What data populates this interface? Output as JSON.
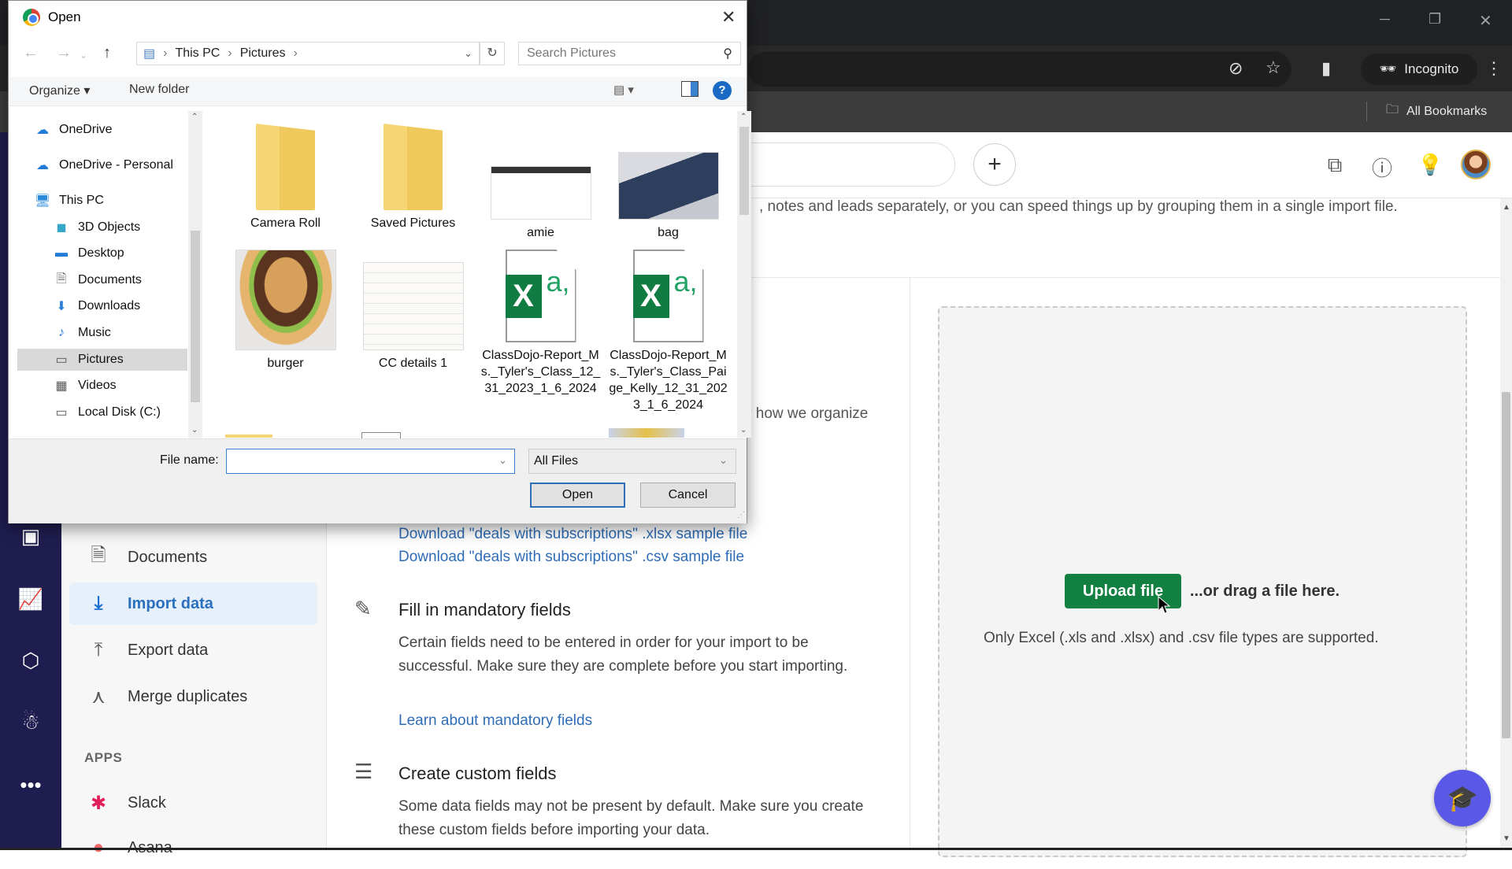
{
  "browser": {
    "incognito_label": "Incognito",
    "bookmarks_label": "All Bookmarks"
  },
  "app": {
    "intro_text": ", notes and leads separately, or you can speed things up by grouping them in a single import file.",
    "behind_text": "y how we organize",
    "subnav": [
      {
        "label": "Documents",
        "icon": "document-icon",
        "glyph": "🗎",
        "active": false
      },
      {
        "label": "Import data",
        "icon": "download-icon",
        "glyph": "⤓",
        "active": true
      },
      {
        "label": "Export data",
        "icon": "upload-icon",
        "glyph": "⤒",
        "active": false
      },
      {
        "label": "Merge duplicates",
        "icon": "merge-icon",
        "glyph": "⋏",
        "active": false
      }
    ],
    "apps_label": "APPS",
    "apps": [
      {
        "label": "Slack",
        "icon": "slack-icon"
      },
      {
        "label": "Asana",
        "icon": "asana-icon"
      }
    ],
    "links": {
      "xlsx_sample": "Download \"deals with subscriptions\" .xlsx sample file",
      "csv_sample": "Download \"deals with subscriptions\" .csv sample file",
      "learn_mandatory": "Learn about mandatory fields"
    },
    "sections": {
      "mandatory": {
        "title": "Fill in mandatory fields",
        "body": "Certain fields need to be entered in order for your import to be successful. Make sure they are complete before you start importing."
      },
      "custom": {
        "title": "Create custom fields",
        "body": "Some data fields may not be present by default. Make sure you create these custom fields before importing your data."
      }
    },
    "upload": {
      "button": "Upload file",
      "drag_text": "...or drag a file here.",
      "supported": "Only Excel (.xls and .xlsx) and .csv file types are supported."
    },
    "accent_color": "#118041",
    "rail_color": "#1f1d4f"
  },
  "dialog": {
    "title": "Open",
    "breadcrumb": [
      "This PC",
      "Pictures"
    ],
    "search_placeholder": "Search Pictures",
    "organize_label": "Organize ▾",
    "new_folder_label": "New folder",
    "nav_items": [
      {
        "label": "OneDrive",
        "icon": "cloud-icon",
        "glyph": "☁",
        "color": "#1f7bd6",
        "sub": false
      },
      {
        "label": "OneDrive - Personal",
        "icon": "cloud-icon",
        "glyph": "☁",
        "color": "#1f7bd6",
        "sub": false
      },
      {
        "label": "This PC",
        "icon": "computer-icon",
        "glyph": "🖥",
        "color": "#2b8ad8",
        "sub": false
      },
      {
        "label": "3D Objects",
        "icon": "cube-icon",
        "glyph": "◼",
        "color": "#35a7c9",
        "sub": true
      },
      {
        "label": "Desktop",
        "icon": "desktop-icon",
        "glyph": "▬",
        "color": "#1f7bd6",
        "sub": true
      },
      {
        "label": "Documents",
        "icon": "document-icon",
        "glyph": "🗎",
        "color": "#666",
        "sub": true
      },
      {
        "label": "Downloads",
        "icon": "download-icon",
        "glyph": "⬇",
        "color": "#2b7fd6",
        "sub": true
      },
      {
        "label": "Music",
        "icon": "music-icon",
        "glyph": "♪",
        "color": "#2b7fd6",
        "sub": true
      },
      {
        "label": "Pictures",
        "icon": "pictures-icon",
        "glyph": "▭",
        "color": "#555",
        "sub": true,
        "selected": true
      },
      {
        "label": "Videos",
        "icon": "video-icon",
        "glyph": "▦",
        "color": "#555",
        "sub": true
      },
      {
        "label": "Local Disk (C:)",
        "icon": "disk-icon",
        "glyph": "▭",
        "color": "#555",
        "sub": true
      }
    ],
    "files": [
      {
        "name": "Camera Roll",
        "type": "folder"
      },
      {
        "name": "Saved Pictures",
        "type": "folder"
      },
      {
        "name": "amie",
        "type": "image"
      },
      {
        "name": "bag",
        "type": "image"
      },
      {
        "name": "burger",
        "type": "image"
      },
      {
        "name": "CC details 1",
        "type": "image"
      },
      {
        "name": "ClassDojo-Report_Ms._Tyler's_Class_12_31_2023_1_6_2024",
        "type": "xlsx"
      },
      {
        "name": "ClassDojo-Report_Ms._Tyler's_Class_Paige_Kelly_12_31_2023_1_6_2024",
        "type": "xlsx"
      }
    ],
    "filename_label": "File name:",
    "filename_value": "",
    "filter_value": "All Files",
    "open_label": "Open",
    "cancel_label": "Cancel"
  }
}
